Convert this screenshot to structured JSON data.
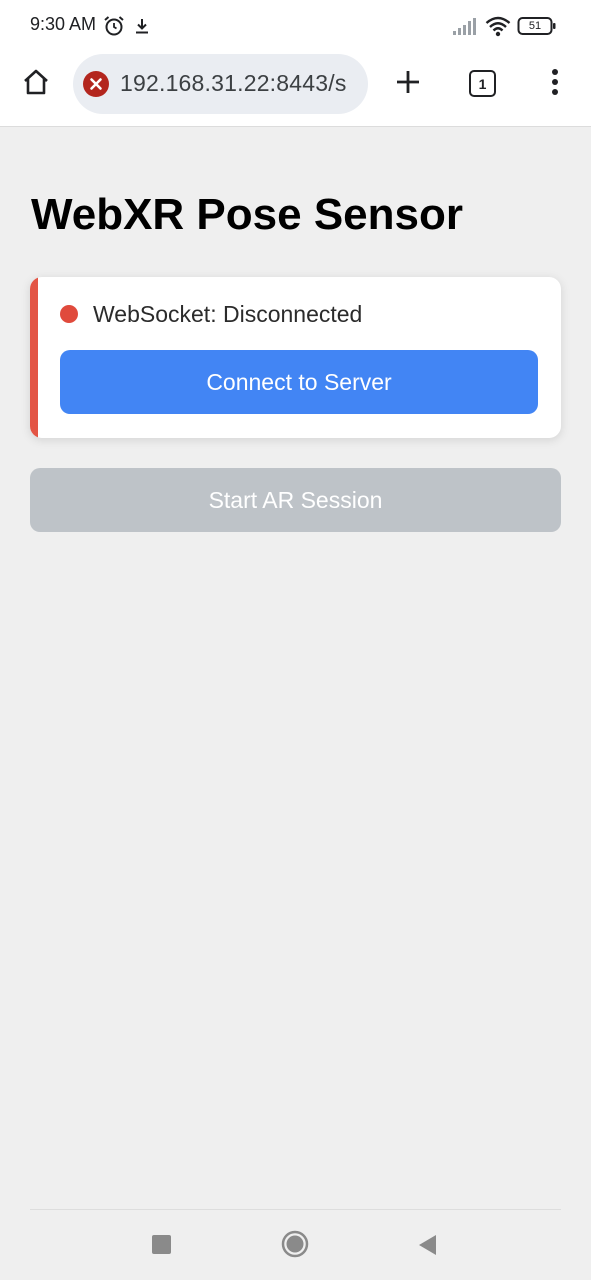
{
  "status_bar": {
    "time": "9:30 AM",
    "battery": "51",
    "icons": [
      "alarm-icon",
      "download-icon",
      "signal-icon",
      "wifi-icon",
      "battery-icon"
    ]
  },
  "browser": {
    "url": "192.168.31.22:8443/s",
    "tab_count": "1",
    "security_color": "#b3261e",
    "icons": [
      "home-icon",
      "security-error-icon",
      "new-tab-icon",
      "tab-switcher-icon",
      "more-menu-icon"
    ]
  },
  "page": {
    "title": "WebXR Pose Sensor",
    "connection_status": "WebSocket: Disconnected",
    "status_color": "#e04a3c",
    "connect_button": "Connect to Server",
    "ar_button": "Start AR Session",
    "accent_color": "#4285f4"
  },
  "nav_bar": {
    "icons": [
      "recents-icon",
      "home-icon",
      "back-icon"
    ]
  }
}
